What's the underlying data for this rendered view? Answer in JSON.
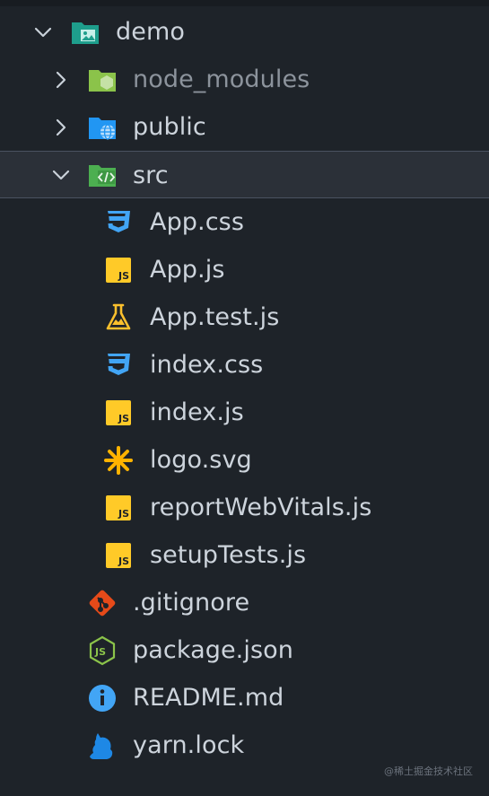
{
  "explorer": {
    "items": [
      {
        "name": "folder-demo",
        "label": "demo",
        "kind": "folder",
        "expanded": true,
        "icon": "folder-image-icon",
        "color": "#1e9e8c"
      },
      {
        "name": "folder-node-modules",
        "label": "node_modules",
        "kind": "folder",
        "expanded": false,
        "icon": "node-modules-folder-icon",
        "color": "#8bc34a"
      },
      {
        "name": "folder-public",
        "label": "public",
        "kind": "folder",
        "expanded": false,
        "icon": "public-folder-icon",
        "color": "#2196f3"
      },
      {
        "name": "folder-src",
        "label": "src",
        "kind": "folder",
        "expanded": true,
        "icon": "src-folder-icon",
        "color": "#4caf50",
        "selected": true
      },
      {
        "name": "file-app-css",
        "label": "App.css",
        "kind": "file",
        "icon": "css-icon",
        "color": "#42a5f5"
      },
      {
        "name": "file-app-js",
        "label": "App.js",
        "kind": "file",
        "icon": "javascript-icon",
        "color": "#ffca28"
      },
      {
        "name": "file-app-test-js",
        "label": "App.test.js",
        "kind": "file",
        "icon": "test-flask-icon",
        "color": "#fbc02d"
      },
      {
        "name": "file-index-css",
        "label": "index.css",
        "kind": "file",
        "icon": "css-icon",
        "color": "#42a5f5"
      },
      {
        "name": "file-index-js",
        "label": "index.js",
        "kind": "file",
        "icon": "javascript-icon",
        "color": "#ffca28"
      },
      {
        "name": "file-logo-svg",
        "label": "logo.svg",
        "kind": "file",
        "icon": "svg-asterisk-icon",
        "color": "#ffb300"
      },
      {
        "name": "file-report-web-vitals-js",
        "label": "reportWebVitals.js",
        "kind": "file",
        "icon": "javascript-icon",
        "color": "#ffca28"
      },
      {
        "name": "file-setup-tests-js",
        "label": "setupTests.js",
        "kind": "file",
        "icon": "javascript-icon",
        "color": "#ffca28"
      },
      {
        "name": "file-gitignore",
        "label": ".gitignore",
        "kind": "file",
        "icon": "git-icon",
        "color": "#e64a19"
      },
      {
        "name": "file-package-json",
        "label": "package.json",
        "kind": "file",
        "icon": "nodejs-icon",
        "color": "#8bc34a"
      },
      {
        "name": "file-readme-md",
        "label": "README.md",
        "kind": "file",
        "icon": "info-icon",
        "color": "#42a5f5"
      },
      {
        "name": "file-yarn-lock",
        "label": "yarn.lock",
        "kind": "file",
        "icon": "yarn-cat-icon",
        "color": "#1e88e5"
      }
    ]
  },
  "watermark": "@稀土掘金技术社区"
}
